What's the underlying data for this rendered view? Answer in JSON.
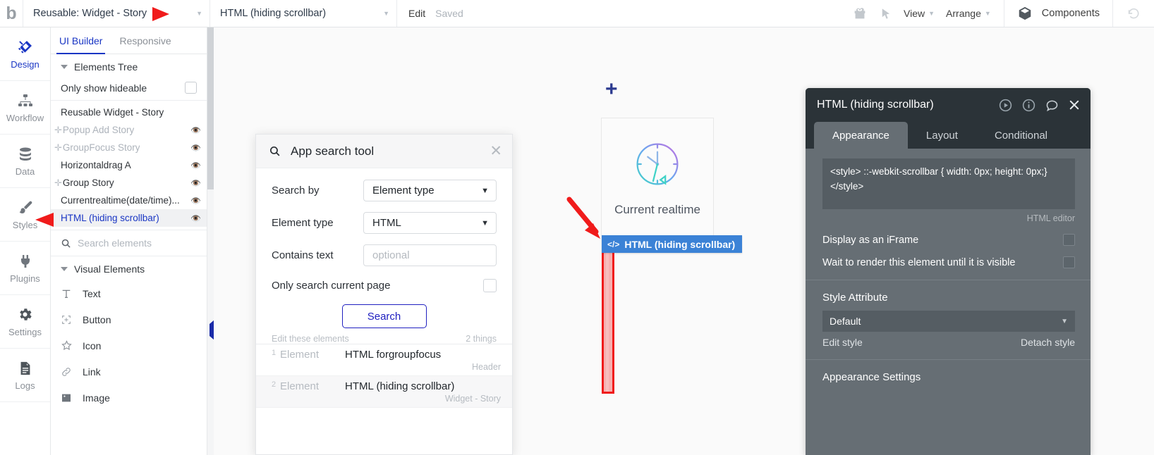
{
  "topbar": {
    "logo": "b",
    "page_select": "Reusable: Widget - Story",
    "element_select": "HTML (hiding scrollbar)",
    "edit_label": "Edit",
    "saved_label": "Saved",
    "gift_icon": "gift-icon",
    "cursor_icon": "cursor-icon",
    "view_label": "View",
    "arrange_label": "Arrange",
    "components_label": "Components",
    "cube_icon": "cube-icon",
    "undo_icon": "undo-icon"
  },
  "rail": {
    "items": [
      {
        "label": "Design",
        "icon": "design-icon",
        "active": true
      },
      {
        "label": "Workflow",
        "icon": "workflow-icon",
        "active": false
      },
      {
        "label": "Data",
        "icon": "data-icon",
        "active": false
      },
      {
        "label": "Styles",
        "icon": "styles-icon",
        "active": false
      },
      {
        "label": "Plugins",
        "icon": "plugins-icon",
        "active": false
      },
      {
        "label": "Settings",
        "icon": "settings-icon",
        "active": false
      },
      {
        "label": "Logs",
        "icon": "logs-icon",
        "active": false
      }
    ]
  },
  "left_panel": {
    "tabs": [
      {
        "label": "UI Builder",
        "active": true
      },
      {
        "label": "Responsive",
        "active": false
      }
    ],
    "elements_tree_label": "Elements Tree",
    "only_show_hideable_label": "Only show hideable",
    "only_show_hideable_checked": false,
    "tree": [
      {
        "label": "Reusable Widget - Story",
        "expandable": false,
        "dim": false,
        "eye": "",
        "selected": false
      },
      {
        "label": "Popup Add Story",
        "expandable": true,
        "dim": true,
        "eye": "eye-slash-icon",
        "selected": false
      },
      {
        "label": "GroupFocus Story",
        "expandable": true,
        "dim": true,
        "eye": "eye-slash-icon",
        "selected": false
      },
      {
        "label": "Horizontaldrag A",
        "expandable": false,
        "dim": false,
        "eye": "eye-icon",
        "selected": false
      },
      {
        "label": "Group Story",
        "expandable": true,
        "dim": false,
        "eye": "eye-icon",
        "selected": false
      },
      {
        "label": "Currentrealtime(date/time)...",
        "expandable": false,
        "dim": false,
        "eye": "eye-icon",
        "selected": false
      },
      {
        "label": "HTML (hiding scrollbar)",
        "expandable": false,
        "dim": false,
        "eye": "eye-icon",
        "selected": true
      }
    ],
    "search_placeholder": "Search elements",
    "visual_elements_label": "Visual Elements",
    "visual_elements": [
      {
        "label": "Text",
        "icon": "text-icon"
      },
      {
        "label": "Button",
        "icon": "button-icon"
      },
      {
        "label": "Icon",
        "icon": "star-icon"
      },
      {
        "label": "Link",
        "icon": "link-icon"
      },
      {
        "label": "Image",
        "icon": "image-icon"
      }
    ]
  },
  "canvas": {
    "plus_marker": "+",
    "widget_caption": "Current realtime",
    "clock_icon": "clock-gauge-icon",
    "element_label": "HTML (hiding scrollbar)",
    "element_label_icon": "code-icon",
    "element_label_color": "#3b82d6",
    "highlight_color": "#f01b1b"
  },
  "search_dialog": {
    "title": "App search tool",
    "search_icon": "search-icon",
    "close_icon": "close-icon",
    "fields": [
      {
        "label": "Search by",
        "value": "Element type",
        "type": "select"
      },
      {
        "label": "Element type",
        "value": "HTML",
        "type": "select"
      },
      {
        "label": "Contains text",
        "value": "",
        "placeholder": "optional",
        "type": "text"
      }
    ],
    "only_current_page_label": "Only search current page",
    "only_current_page_checked": false,
    "search_button": "Search",
    "results_caption": "Edit these elements",
    "results_count": "2 things",
    "results": [
      {
        "index": "1",
        "type": "Element",
        "name": "HTML forgroupfocus",
        "location": "Header"
      },
      {
        "index": "2",
        "type": "Element",
        "name": "HTML (hiding scrollbar)",
        "location": "Widget - Story"
      }
    ]
  },
  "right_panel": {
    "title": "HTML (hiding scrollbar)",
    "header_icons": [
      "play-icon",
      "info-icon",
      "comment-icon",
      "close-icon"
    ],
    "tabs": [
      {
        "label": "Appearance",
        "active": true
      },
      {
        "label": "Layout",
        "active": false
      },
      {
        "label": "Conditional",
        "active": false
      }
    ],
    "code_value": "<style> ::-webkit-scrollbar { width: 0px; height: 0px;} </style>",
    "code_hint": "HTML editor",
    "options": [
      {
        "label": "Display as an iFrame",
        "checked": false
      },
      {
        "label": "Wait to render this element until it is visible",
        "checked": false
      }
    ],
    "style_attribute_label": "Style Attribute",
    "style_value": "Default",
    "edit_style_label": "Edit style",
    "detach_style_label": "Detach style",
    "appearance_settings_label": "Appearance Settings"
  }
}
